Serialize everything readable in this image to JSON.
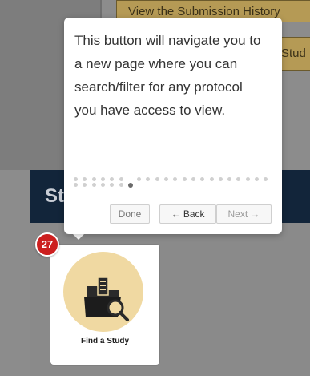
{
  "background": {
    "history_button_label": "View the Submission History",
    "study_button_label": "Stud",
    "section_header_label": "St"
  },
  "tooltip": {
    "text": "This button will navigate you to a new page where you can search/filter for any protocol you have access to view.",
    "progress": {
      "total_steps": 28,
      "current_step": 7
    },
    "done_label": "Done",
    "back_label": "← Back",
    "next_label": "Next →"
  },
  "step_badge": "27",
  "card": {
    "label": "Find a Study",
    "icon": "folder-search-icon"
  },
  "colors": {
    "badge_red": "#cc1f1f",
    "card_icon_circle": "#f0d9a2",
    "header_navy": "#12253a",
    "gold_button": "#b59a55"
  }
}
